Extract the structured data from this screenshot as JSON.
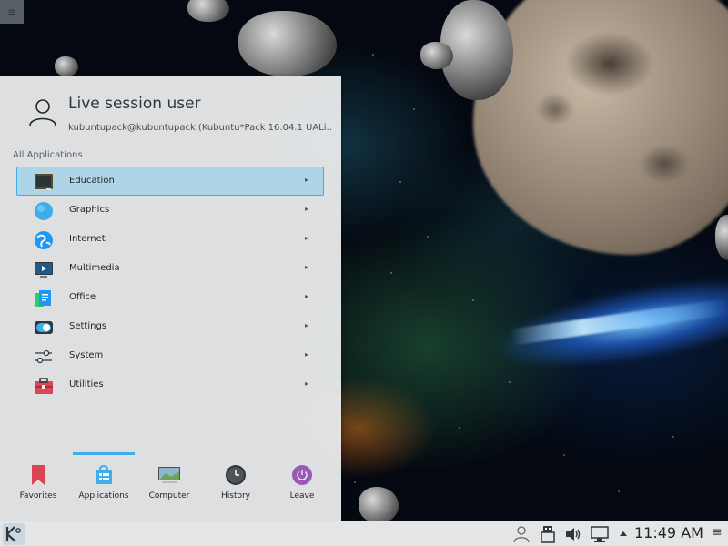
{
  "launcher": {
    "user_name": "Live session user",
    "user_host": "kubuntupack@kubuntupack (Kubuntu*Pack 16.04.1 UALi...",
    "section_title": "All Applications",
    "categories": [
      {
        "label": "Education",
        "icon": "education-icon",
        "selected": true
      },
      {
        "label": "Graphics",
        "icon": "graphics-icon"
      },
      {
        "label": "Internet",
        "icon": "internet-icon"
      },
      {
        "label": "Multimedia",
        "icon": "multimedia-icon"
      },
      {
        "label": "Office",
        "icon": "office-icon"
      },
      {
        "label": "Settings",
        "icon": "settings-icon"
      },
      {
        "label": "System",
        "icon": "system-icon"
      },
      {
        "label": "Utilities",
        "icon": "utilities-icon"
      }
    ],
    "tabs": [
      {
        "label": "Favorites",
        "icon": "bookmark-icon"
      },
      {
        "label": "Applications",
        "icon": "applications-icon",
        "active": true
      },
      {
        "label": "Computer",
        "icon": "computer-icon"
      },
      {
        "label": "History",
        "icon": "clock-icon"
      },
      {
        "label": "Leave",
        "icon": "power-icon"
      }
    ]
  },
  "taskbar": {
    "clock": "11:49 AM",
    "tray_icons": [
      "user-icon",
      "usb-icon",
      "volume-icon",
      "network-icon",
      "expand-arrow-icon",
      "menu-icon"
    ]
  },
  "colors": {
    "accent": "#3daee9",
    "selection_bg": "#93cee9",
    "panel_bg": "#eff0f1",
    "taskbar_bg": "#e3e5e7"
  }
}
